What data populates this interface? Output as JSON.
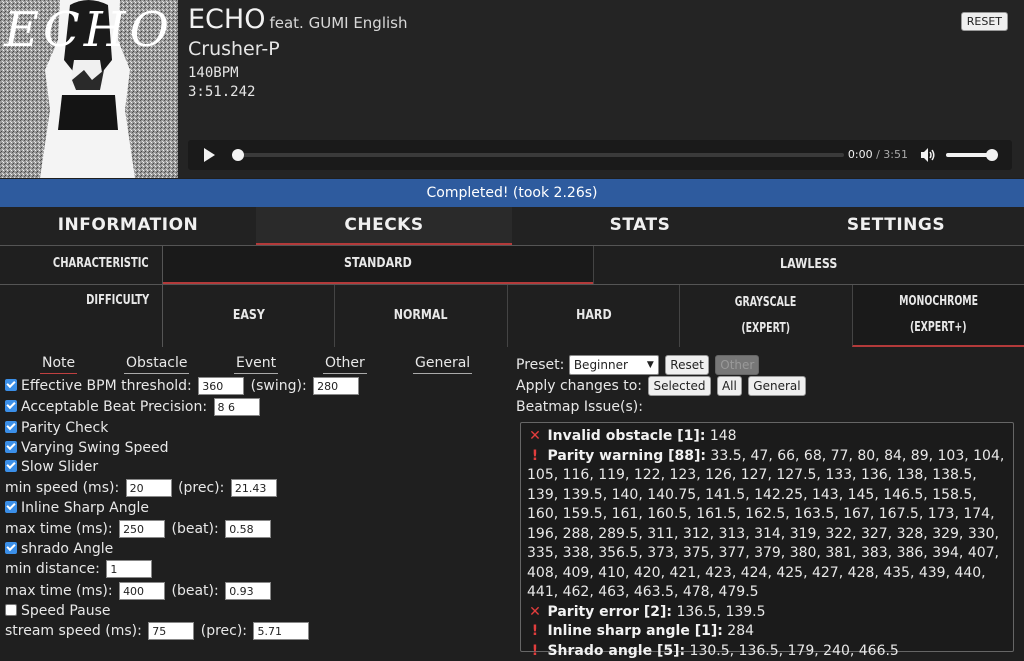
{
  "song": {
    "title": "ECHO",
    "subtitle": "feat. GUMI English",
    "artist": "Crusher-P",
    "bpm": "140BPM",
    "duration": "3:51.242",
    "cover_text": "ECHO"
  },
  "header": {
    "reset_label": "RESET"
  },
  "player": {
    "current": "0:00",
    "total": "/ 3:51",
    "progress": 0,
    "volume": 1.0
  },
  "status": "Completed! (took 2.26s)",
  "main_tabs": [
    "INFORMATION",
    "CHECKS",
    "STATS",
    "SETTINGS"
  ],
  "active_main_tab": 1,
  "characteristic": {
    "label": "CHARACTERISTIC",
    "options": [
      "STANDARD",
      "LAWLESS"
    ],
    "active": 0
  },
  "difficulty": {
    "label": "DIFFICULTY",
    "options": [
      "EASY",
      "NORMAL",
      "HARD",
      "GRAYSCALE",
      "MONOCHROME"
    ],
    "sublabels": [
      "",
      "",
      "",
      "(EXPERT)",
      "(EXPERT+)"
    ],
    "active": 4
  },
  "check_tabs": [
    "Note",
    "Obstacle",
    "Event",
    "Other",
    "General"
  ],
  "checks": {
    "ebpm_label": "Effective BPM threshold:",
    "ebpm": "360",
    "swing_label": "(swing):",
    "swing": "280",
    "precision_label": "Acceptable Beat Precision:",
    "precision": "8 6",
    "parity_label": "Parity Check",
    "vss_label": "Varying Swing Speed",
    "slow_label": "Slow Slider",
    "min_speed_label": "min speed (ms):",
    "min_speed": "20",
    "prec_label": "(prec):",
    "min_speed_prec": "21.43",
    "inline_label": "Inline Sharp Angle",
    "max_time_label": "max time (ms):",
    "inline_max_time": "250",
    "beat_label": "(beat):",
    "inline_beat": "0.58",
    "shrado_label": "shrado Angle",
    "min_dist_label": "min distance:",
    "shrado_min_dist": "1",
    "shrado_max_time": "400",
    "shrado_beat": "0.93",
    "speed_pause_label": "Speed Pause",
    "stream_label": "stream speed (ms):",
    "stream_speed": "75",
    "stream_prec": "5.71"
  },
  "preset": {
    "label": "Preset:",
    "value": "Beginner",
    "reset_label": "Reset",
    "other_label": "Other",
    "apply_label": "Apply changes to:",
    "selected_label": "Selected",
    "all_label": "All",
    "general_label": "General"
  },
  "issues_label": "Beatmap Issue(s):",
  "issues": [
    {
      "type": "error",
      "title": "Invalid obstacle [1]:",
      "text": " 148"
    },
    {
      "type": "warning",
      "title": "Parity warning [88]:",
      "text": " 33.5, 47, 66, 68, 77, 80, 84, 89, 103, 104, 105, 116, 119, 122, 123, 126, 127, 127.5, 133, 136, 138, 138.5, 139, 139.5, 140, 140.75, 141.5, 142.25, 143, 145, 146.5, 158.5, 160, 159.5, 161, 160.5, 161.5, 162.5, 163.5, 167, 167.5, 173, 174, 196, 288, 289.5, 311, 312, 313, 314, 319, 322, 327, 328, 329, 330, 335, 338, 356.5, 373, 375, 377, 379, 380, 381, 383, 386, 394, 407, 408, 409, 410, 420, 421, 423, 424, 425, 427, 428, 435, 439, 440, 441, 462, 463, 463.5, 478, 479.5"
    },
    {
      "type": "error",
      "title": "Parity error [2]:",
      "text": " 136.5, 139.5"
    },
    {
      "type": "warning",
      "title": "Inline sharp angle [1]:",
      "text": " 284"
    },
    {
      "type": "warning",
      "title": "Shrado angle [5]:",
      "text": " 130.5, 136.5, 179, 240, 466.5"
    }
  ],
  "colors": {
    "status_bar": "#2e5b9e",
    "active_underline": "#b33a3a",
    "error_icon": "#e23d3d",
    "checkbox": "#3b8fe8"
  }
}
